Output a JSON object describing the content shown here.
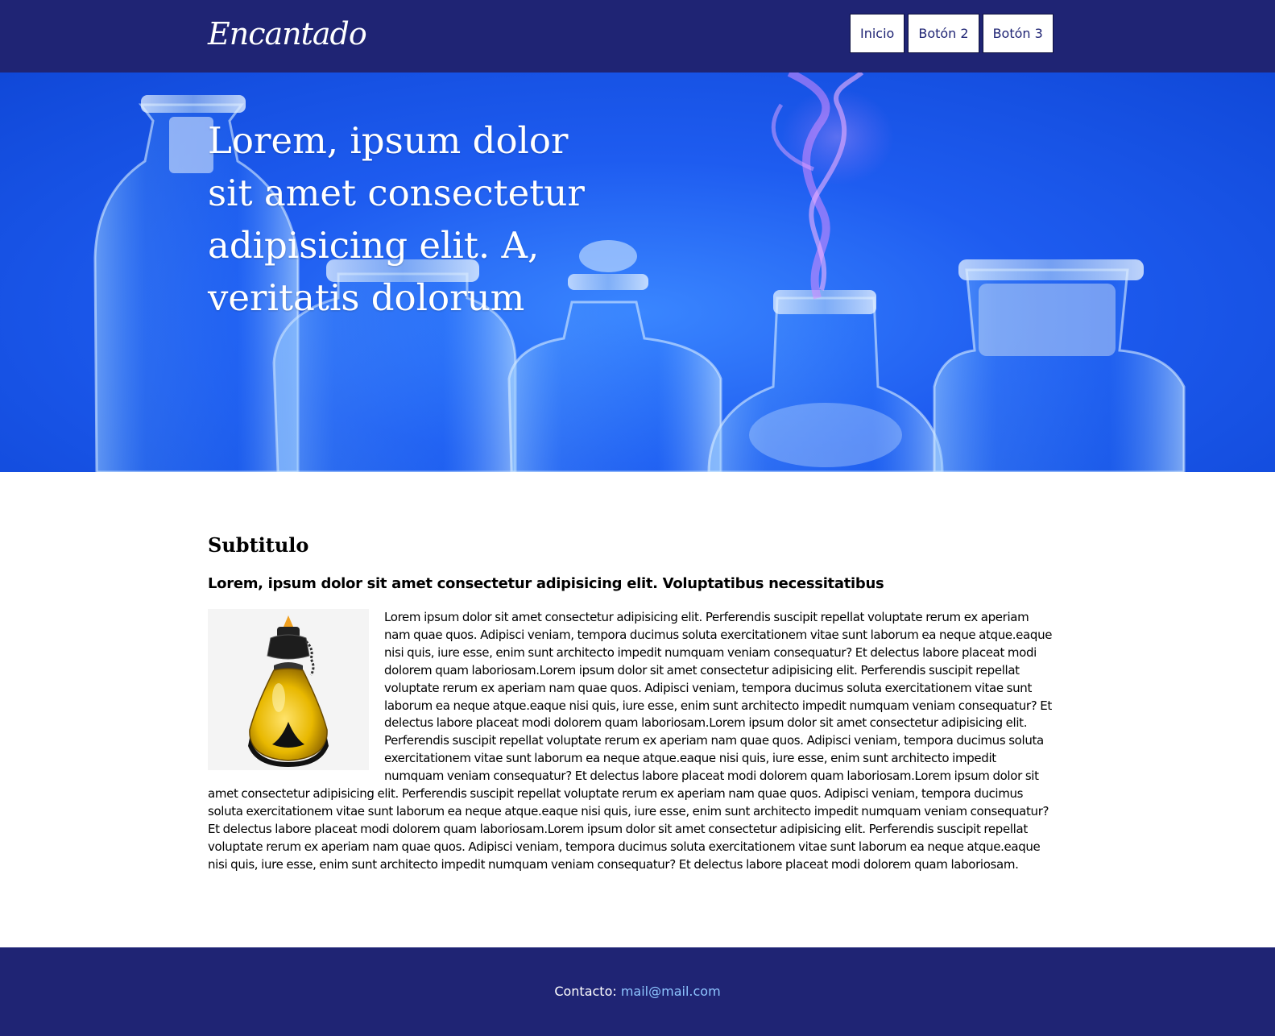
{
  "header": {
    "logo_text": "Encantado",
    "nav": [
      {
        "label": "Inicio"
      },
      {
        "label": "Botón 2"
      },
      {
        "label": "Botón 3"
      }
    ]
  },
  "hero": {
    "title": "Lorem, ipsum dolor sit amet consectetur adipisicing elit. A, veritatis dolorum"
  },
  "main": {
    "subtitle": "Subtitulo",
    "lead": "Lorem, ipsum dolor sit amet consectetur adipisicing elit. Voluptatibus necessitatibus",
    "body": "Lorem ipsum dolor sit amet consectetur adipisicing elit. Perferendis suscipit repellat voluptate rerum ex aperiam nam quae quos. Adipisci veniam, tempora ducimus soluta exercitationem vitae sunt laborum ea neque atque.eaque nisi quis, iure esse, enim sunt architecto impedit numquam veniam consequatur? Et delectus labore placeat modi dolorem quam laboriosam.Lorem ipsum dolor sit amet consectetur adipisicing elit. Perferendis suscipit repellat voluptate rerum ex aperiam nam quae quos. Adipisci veniam, tempora ducimus soluta exercitationem vitae sunt laborum ea neque atque.eaque nisi quis, iure esse, enim sunt architecto impedit numquam veniam consequatur? Et delectus labore placeat modi dolorem quam laboriosam.Lorem ipsum dolor sit amet consectetur adipisicing elit. Perferendis suscipit repellat voluptate rerum ex aperiam nam quae quos. Adipisci veniam, tempora ducimus soluta exercitationem vitae sunt laborum ea neque atque.eaque nisi quis, iure esse, enim sunt architecto impedit numquam veniam consequatur? Et delectus labore placeat modi dolorem quam laboriosam.Lorem ipsum dolor sit amet consectetur adipisicing elit. Perferendis suscipit repellat voluptate rerum ex aperiam nam quae quos. Adipisci veniam, tempora ducimus soluta exercitationem vitae sunt laborum ea neque atque.eaque nisi quis, iure esse, enim sunt architecto impedit numquam veniam consequatur? Et delectus labore placeat modi dolorem quam laboriosam.Lorem ipsum dolor sit amet consectetur adipisicing elit. Perferendis suscipit repellat voluptate rerum ex aperiam nam quae quos. Adipisci veniam, tempora ducimus soluta exercitationem vitae sunt laborum ea neque atque.eaque nisi quis, iure esse, enim sunt architecto impedit numquam veniam consequatur? Et delectus labore placeat modi dolorem quam laboriosam."
  },
  "footer": {
    "contact_label": "Contacto:",
    "email": "mail@mail.com"
  },
  "colors": {
    "brand_navy": "#1f2474",
    "hero_blue": "#1e5cf0",
    "link": "#8ec5ff"
  }
}
